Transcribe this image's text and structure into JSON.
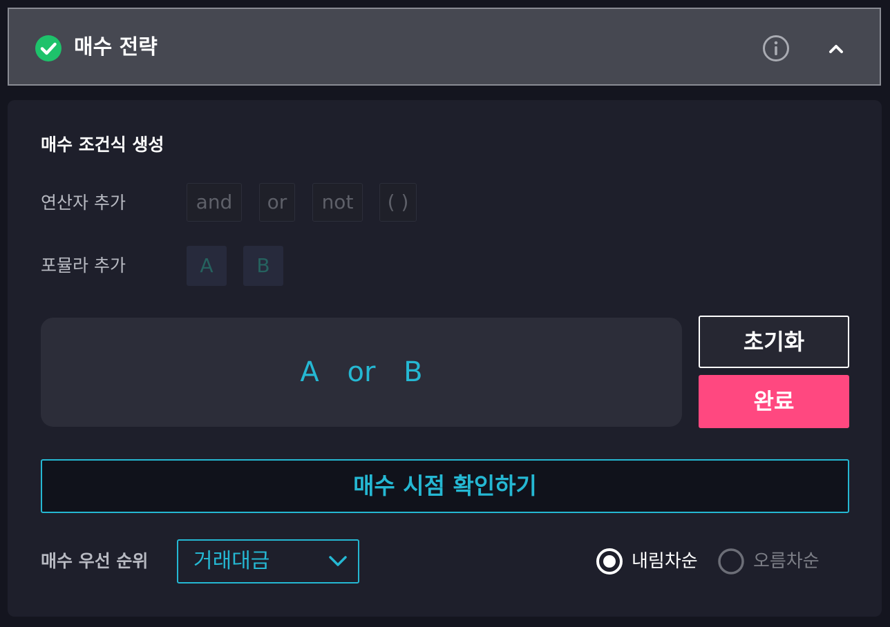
{
  "header": {
    "title": "매수 전략",
    "status_icon": "check-circle-icon",
    "status_color": "#1ec26b",
    "info_icon": "info-icon",
    "collapse_icon": "chevron-up-icon"
  },
  "builder": {
    "section_title": "매수 조건식 생성",
    "operators_label": "연산자 추가",
    "operators": [
      "and",
      "or",
      "not",
      "( )"
    ],
    "formulas_label": "포뮬라 추가",
    "formulas": [
      "A",
      "B"
    ],
    "expression": "A or B",
    "reset_label": "초기화",
    "done_label": "완료"
  },
  "confirm": {
    "label": "매수 시점 확인하기"
  },
  "priority": {
    "label": "매수 우선 순위",
    "selected": "거래대금",
    "sort_options": [
      {
        "label": "내림차순",
        "selected": true
      },
      {
        "label": "오름차순",
        "selected": false
      }
    ]
  },
  "colors": {
    "accent": "#25b8d3",
    "primary_button": "#ff4880",
    "background": "#14151f",
    "panel": "#1e1f2b"
  }
}
